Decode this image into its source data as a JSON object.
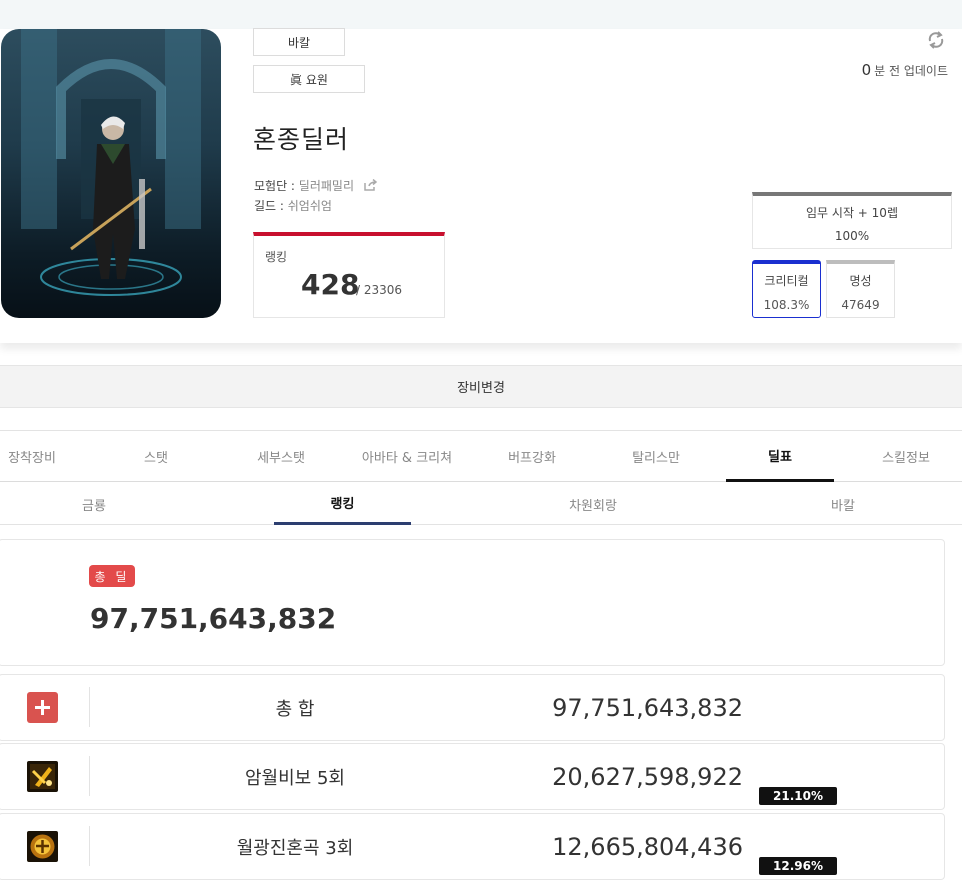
{
  "profile": {
    "server": "바칼",
    "class_name": "眞 요원",
    "character_name": "혼종딜러",
    "adventure_label": "모험단 : ",
    "adventure_value": "딜러패밀리",
    "guild_label": "길드 : ",
    "guild_value": "쉬엄쉬엄",
    "rank_label": "랭킹",
    "rank_value": "428",
    "rank_total": "/ 23306",
    "update_minutes": "0",
    "update_text": "분 전 업데이트",
    "stats": {
      "mission_label": "임무 시작 + 10렙",
      "mission_value": "100%",
      "crit_label": "크리티컬",
      "crit_value": "108.3%",
      "fame_label": "명성",
      "fame_value": "47649"
    }
  },
  "equip_change_label": "장비변경",
  "tabs": [
    {
      "label": "장착장비"
    },
    {
      "label": "스탯"
    },
    {
      "label": "세부스탯"
    },
    {
      "label": "아바타 & 크리쳐"
    },
    {
      "label": "버프강화"
    },
    {
      "label": "탈리스만"
    },
    {
      "label": "딜표"
    },
    {
      "label": "스킬정보"
    }
  ],
  "subtabs": [
    {
      "label": "금룡"
    },
    {
      "label": "랭킹"
    },
    {
      "label": "차원회랑"
    },
    {
      "label": "바칼"
    }
  ],
  "total": {
    "badge": "총 딜",
    "value": "97,751,643,832"
  },
  "rows": [
    {
      "name": "총 합",
      "value": "97,751,643,832",
      "icon": "plus-icon"
    },
    {
      "name": "암월비보 5회",
      "value": "20,627,598,922",
      "percent": "21.10%",
      "icon": "skill-amwol-icon"
    },
    {
      "name": "월광진혼곡 3회",
      "value": "12,665,804,436",
      "percent": "12.96%",
      "icon": "skill-wolgwang-icon"
    }
  ],
  "colors": {
    "rank_accent": "#c8102e",
    "crit_border": "#1a2fd0",
    "subtab_underline": "#2c3e70",
    "badge_red": "#e34a4a"
  }
}
